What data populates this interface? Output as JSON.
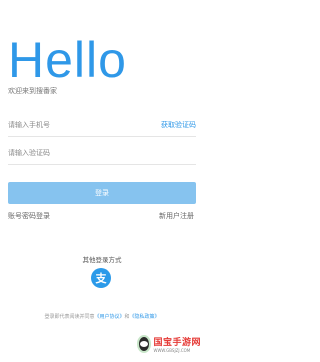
{
  "header": {
    "title": "Hello",
    "subtitle": "欢迎来到搜番家"
  },
  "login_form": {
    "phone_placeholder": "请输入手机号",
    "get_code_label": "获取验证码",
    "code_placeholder": "请输入验证码",
    "submit_label": "登录"
  },
  "links": {
    "password_login": "账号密码登录",
    "new_user_register": "新用户注册"
  },
  "other_login": {
    "title": "其他登录方式",
    "alipay_glyph": "支",
    "alipay_icon": "alipay-icon",
    "alipay_color": "#2b9ae9"
  },
  "agreement": {
    "prefix": "登录即代表阅读并同意",
    "user_agreement": "《用户协议》",
    "and": "和",
    "privacy_policy": "《隐私政策》"
  },
  "watermark": {
    "name": "国宝手游网",
    "url": "WWW.GBSJZJ.COM"
  },
  "colors": {
    "accent": "#2f98e8",
    "button_bg": "#86c3ef"
  }
}
